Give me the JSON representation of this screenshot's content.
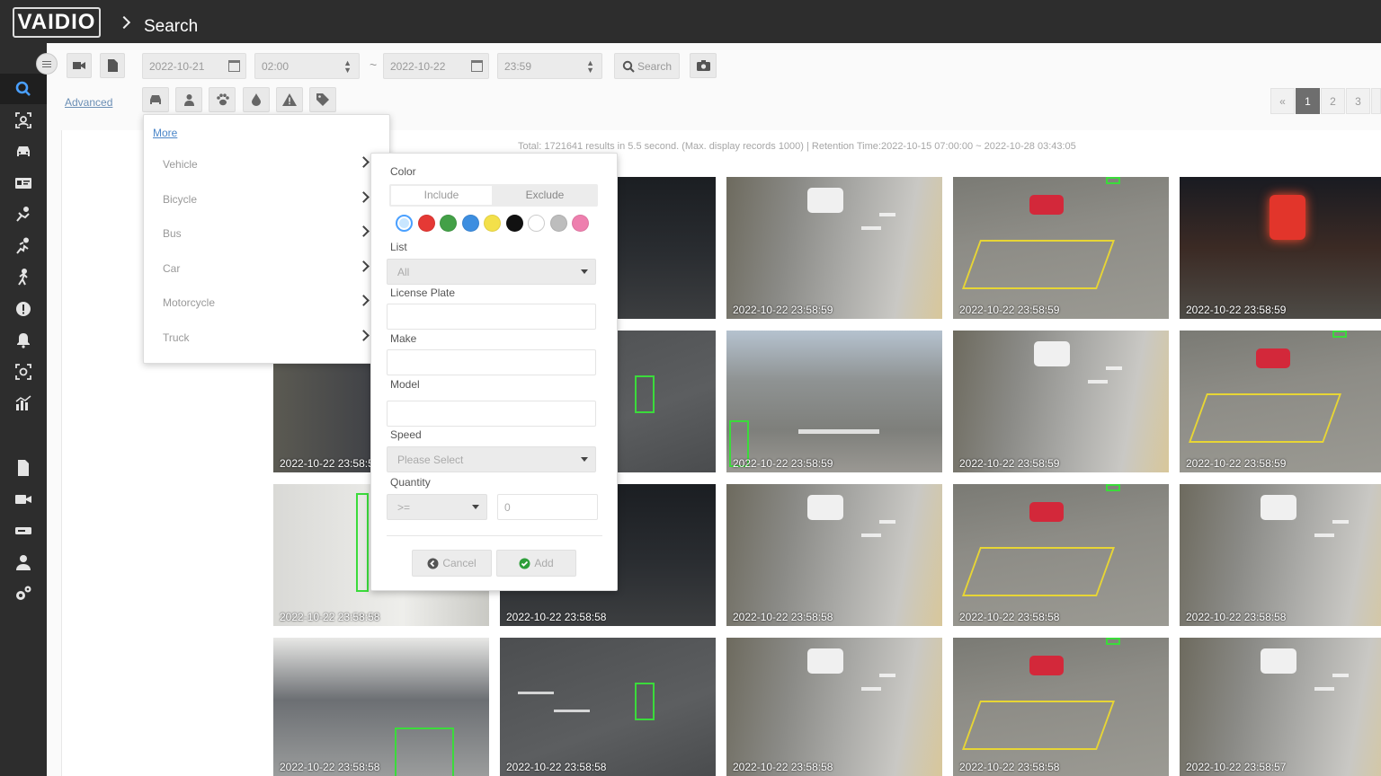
{
  "app": {
    "logo": "VAIDIO",
    "page_title": "Search"
  },
  "sidebar": {
    "items": [
      {
        "name": "search-icon",
        "active": true
      },
      {
        "name": "face-scan-icon"
      },
      {
        "name": "car-icon"
      },
      {
        "name": "id-card-icon"
      },
      {
        "name": "fall-person-icon"
      },
      {
        "name": "running-person-icon"
      },
      {
        "name": "walking-person-icon"
      },
      {
        "name": "alert-icon"
      },
      {
        "name": "bell-icon"
      },
      {
        "name": "camera-scan-icon"
      },
      {
        "name": "chart-icon"
      },
      {
        "name": "document-icon"
      },
      {
        "name": "video-icon"
      },
      {
        "name": "server-icon"
      },
      {
        "name": "user-icon"
      },
      {
        "name": "settings-icon"
      }
    ]
  },
  "toolbar": {
    "start_date": "2022-10-21",
    "start_time": "02:00",
    "separator": "~",
    "end_date": "2022-10-22",
    "end_time": "23:59",
    "search_label": "Search",
    "advanced_label": "Advanced"
  },
  "pagination": {
    "prev": "«",
    "pages": [
      "1",
      "2",
      "3"
    ],
    "current": "1"
  },
  "results": {
    "summary": "Total: 1721641 results in 5.5 second. (Max. display records 1000) | Retention Time:2022-10-15 07:00:00 ~ 2022-10-28 03:43:05"
  },
  "more_menu": {
    "link": "More",
    "items": [
      "Vehicle",
      "Bicycle",
      "Bus",
      "Car",
      "Motorcycle",
      "Truck"
    ]
  },
  "vehicle_panel": {
    "color_label": "Color",
    "include_label": "Include",
    "exclude_label": "Exclude",
    "colors": [
      "#c9e6ff",
      "#e53935",
      "#43a047",
      "#3d8ee0",
      "#f3e04a",
      "#111111",
      "#ffffff",
      "#bdbdbd",
      "#ee7fae"
    ],
    "list_label": "List",
    "list_value": "All",
    "plate_label": "License Plate",
    "make_label": "Make",
    "model_label": "Model",
    "speed_label": "Speed",
    "speed_placeholder": "Please Select",
    "quantity_label": "Quantity",
    "quantity_operator": ">=",
    "quantity_value": "0",
    "cancel_label": "Cancel",
    "add_label": "Add"
  },
  "thumbnails": [
    {
      "ts": "",
      "scene": "night"
    },
    {
      "ts": "2022-10-22 23:58:59",
      "scene": "street"
    },
    {
      "ts": "2022-10-22 23:58:59",
      "scene": "junction"
    },
    {
      "ts": "2022-10-22 23:58:59",
      "scene": "night-city"
    },
    {
      "ts": "2022-10-22 23:58:59",
      "scene": "alley"
    },
    {
      "ts": "",
      "scene": "road"
    },
    {
      "ts": "2022-10-22 23:58:59",
      "scene": "town"
    },
    {
      "ts": "2022-10-22 23:58:59",
      "scene": "street"
    },
    {
      "ts": "2022-10-22 23:58:59",
      "scene": "junction"
    },
    {
      "ts": "2022-10-22 23:58:58",
      "scene": "indoor"
    },
    {
      "ts": "2022-10-22 23:58:58",
      "scene": "night"
    },
    {
      "ts": "2022-10-22 23:58:58",
      "scene": "street"
    },
    {
      "ts": "2022-10-22 23:58:58",
      "scene": "junction"
    },
    {
      "ts": "2022-10-22 23:58:58",
      "scene": "street"
    },
    {
      "ts": "2022-10-22 23:58:58",
      "scene": "office"
    },
    {
      "ts": "2022-10-22 23:58:58",
      "scene": "road"
    },
    {
      "ts": "2022-10-22 23:58:58",
      "scene": "street"
    },
    {
      "ts": "2022-10-22 23:58:58",
      "scene": "junction"
    },
    {
      "ts": "2022-10-22 23:58:57",
      "scene": "street"
    }
  ]
}
